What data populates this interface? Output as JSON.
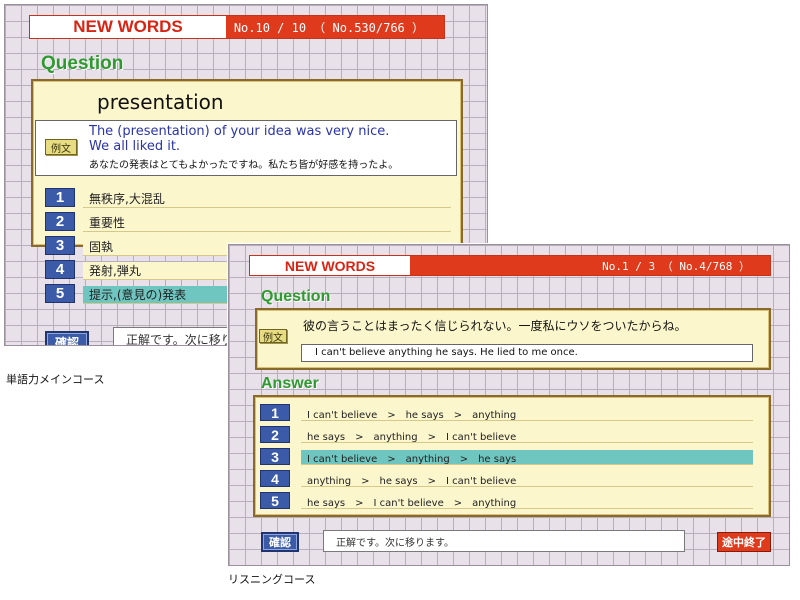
{
  "vocab_screen": {
    "header_title": "NEW WORDS",
    "header_count": "No.10 / 10 （ No.530/766 ）",
    "question_label": "Question",
    "word": "presentation",
    "example_button": "例文",
    "example_en_line1": "The (presentation) of your idea was very nice.",
    "example_en_line2": "We all liked it.",
    "example_ja": "あなたの発表はとてもよかったですね。私たち皆が好感を持ったよ。",
    "choices": [
      {
        "num": "1",
        "text": "無秩序,大混乱"
      },
      {
        "num": "2",
        "text": "重要性"
      },
      {
        "num": "3",
        "text": "固執"
      },
      {
        "num": "4",
        "text": "発射,弾丸"
      },
      {
        "num": "5",
        "text": "提示,(意見の)発表"
      }
    ],
    "selected_index": 4,
    "confirm_button": "確認",
    "status_text": "正解です。次に移りま"
  },
  "listening_screen": {
    "header_title": "NEW WORDS",
    "header_count": "No.1 / 3 （ No.4/768 ）",
    "question_label": "Question",
    "example_button": "例文",
    "question_ja": "彼の言うことはまったく信じられない。一度私にウソをついたからね。",
    "question_en": "I can't believe anything he says. He lied to me once.",
    "answer_label": "Answer",
    "choices": [
      {
        "num": "1",
        "text": "I can't believe　>　he says　>　anything"
      },
      {
        "num": "2",
        "text": "he says　>　anything　>　I can't believe"
      },
      {
        "num": "3",
        "text": "I can't believe　>　anything　>　he says"
      },
      {
        "num": "4",
        "text": "anything　>　he says　>　I can't believe"
      },
      {
        "num": "5",
        "text": "he says　>　I can't believe　>　anything"
      }
    ],
    "selected_index": 2,
    "confirm_button": "確認",
    "status_text": "正解です。次に移ります。",
    "quit_button": "途中終了"
  },
  "captions": {
    "vocab": "単語力メインコース",
    "listening": "リスニングコース"
  },
  "colors": {
    "header_red": "#e03a1c",
    "title_red": "#d92414",
    "label_green": "#2f9a2f",
    "number_blue": "#3b5ba8",
    "panel_cream": "#fbf6cc",
    "selected_teal": "#6fc6c0"
  }
}
